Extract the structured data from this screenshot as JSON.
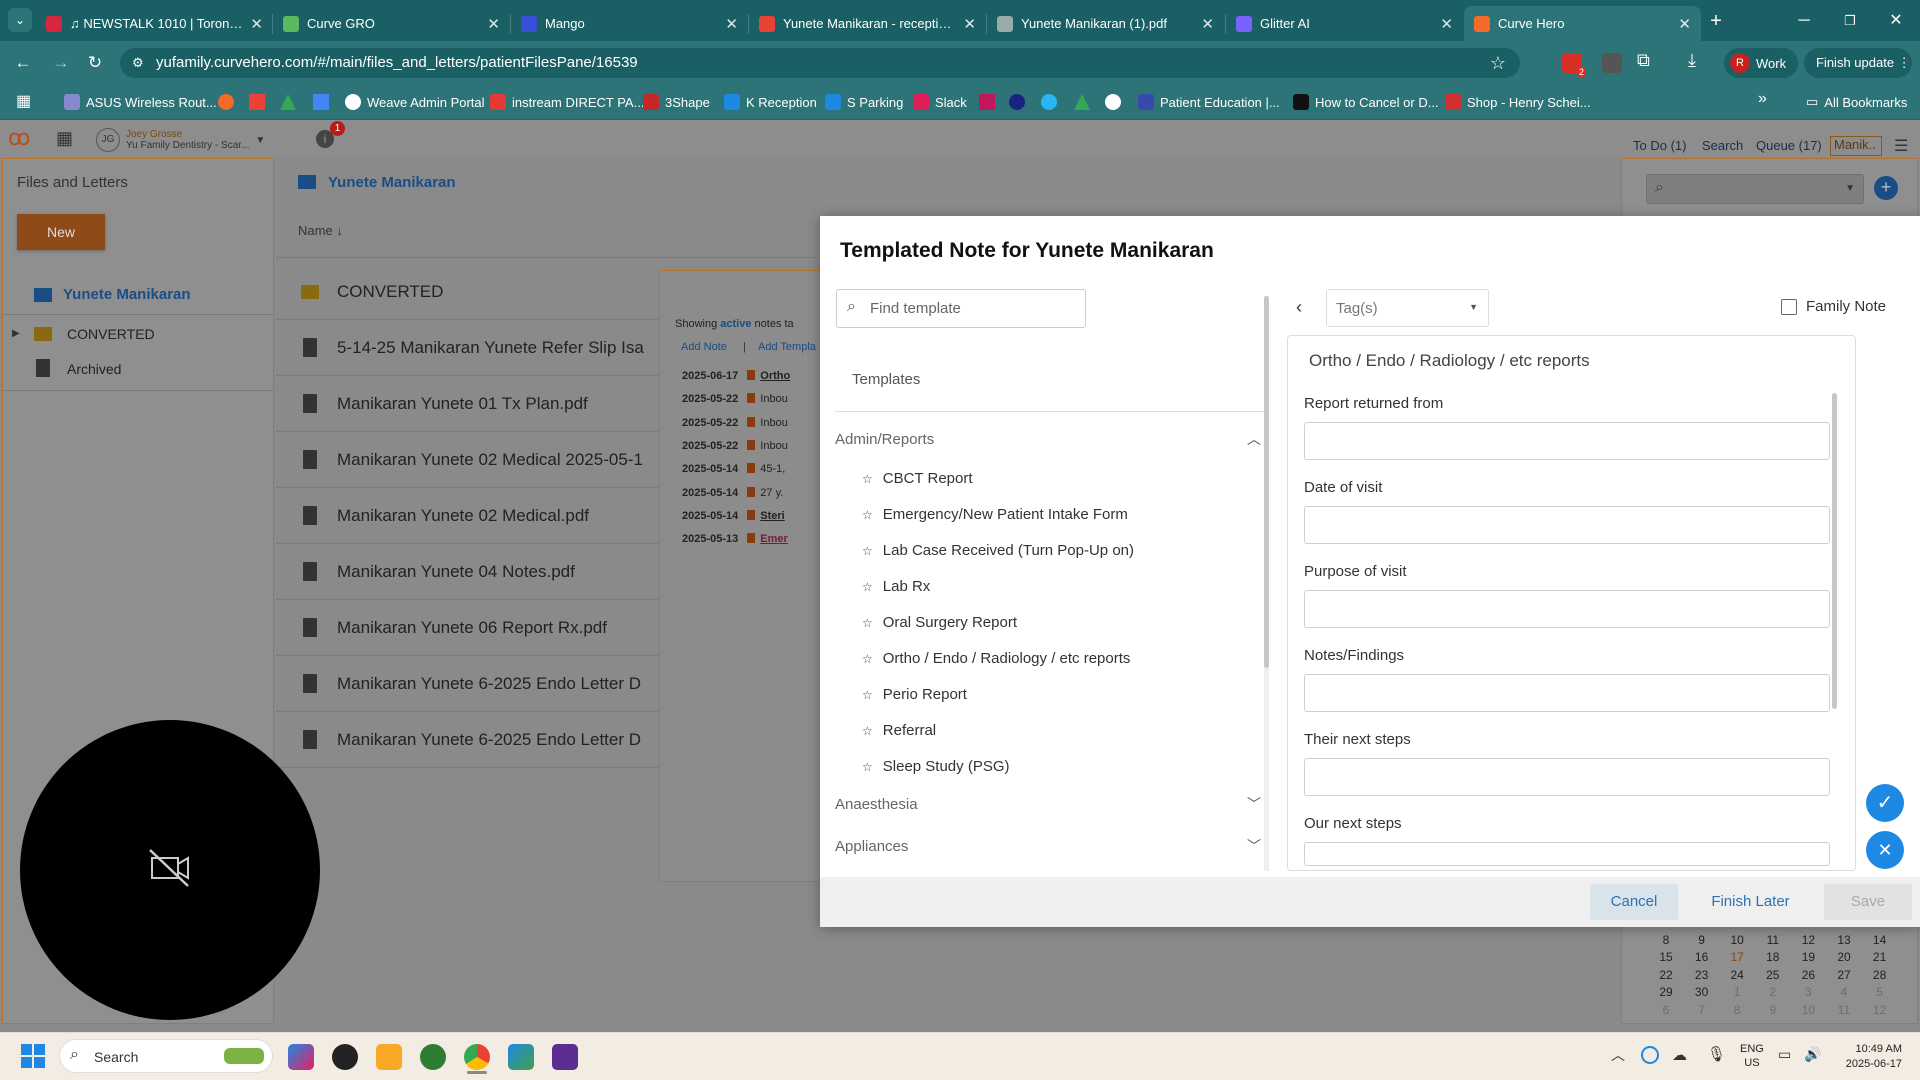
{
  "browser": {
    "tabs": [
      {
        "title": "♫ NEWSTALK 1010 | Toronto's r",
        "icon": "heart-radio-icon",
        "color": "#d7263d"
      },
      {
        "title": "Curve GRO",
        "icon": "curve-gro-icon",
        "color": "#5cb85c"
      },
      {
        "title": "Mango",
        "icon": "mango-icon",
        "color": "#3a4fd8"
      },
      {
        "title": "Yunete Manikaran - reception@",
        "icon": "gmail-icon",
        "color": "#ea4335"
      },
      {
        "title": "Yunete Manikaran (1).pdf",
        "icon": "globe-icon",
        "color": "#9aa"
      },
      {
        "title": "Glitter AI",
        "icon": "glitter-icon",
        "color": "#7b61ff"
      },
      {
        "title": "Curve Hero",
        "icon": "curve-hero-icon",
        "color": "#f26b2a"
      }
    ],
    "url": "yufamily.curvehero.com/#/main/files_and_letters/patientFilesPane/16539",
    "profile_label": "Work",
    "profile_initial": "R",
    "finish_update_label": "Finish update",
    "ext_badge": "2",
    "bookmarks": [
      "ASUS Wireless Rout...",
      "Weave Admin Portal",
      "instream DIRECT PA...",
      "3Shape",
      "K Reception",
      "S Parking",
      "Slack",
      "Patient Education |...",
      "How to Cancel or D...",
      "Shop - Henry Schei..."
    ],
    "all_bookmarks": "All Bookmarks"
  },
  "app": {
    "user_initials": "JG",
    "user_name": "Joey Grosse",
    "practice": "Yu Family Dentistry - Scar...",
    "info_badge": "1",
    "top_links": [
      "To Do (1)",
      "Search",
      "Queue (17)",
      "Manik.."
    ],
    "sidebar": {
      "title": "Files and Letters",
      "new_label": "New",
      "patient": "Yunete Manikaran",
      "folders": [
        "CONVERTED",
        "Archived"
      ]
    },
    "files": {
      "header": "Yunete Manikaran",
      "name_col": "Name",
      "items": [
        "CONVERTED",
        "5-14-25 Manikaran Yunete Refer Slip Isa",
        "Manikaran Yunete 01 Tx Plan.pdf",
        "Manikaran Yunete 02 Medical 2025-05-1",
        "Manikaran Yunete 02 Medical.pdf",
        "Manikaran Yunete 04 Notes.pdf",
        "Manikaran Yunete 06 Report Rx.pdf",
        "Manikaran Yunete 6-2025 Endo Letter D",
        "Manikaran Yunete 6-2025 Endo Letter D"
      ]
    },
    "notes_panel": {
      "showing": "Showing",
      "active": "active",
      "notes_tag": "notes ta",
      "add_note": "Add Note",
      "sep": "|",
      "add_template": "Add Templa",
      "rows": [
        {
          "date": "2025-06-17",
          "text": "Ortho"
        },
        {
          "date": "2025-05-22",
          "text": "Inbou"
        },
        {
          "date": "2025-05-22",
          "text": "Inbou"
        },
        {
          "date": "2025-05-22",
          "text": "Inbou"
        },
        {
          "date": "2025-05-14",
          "text": "45-1,"
        },
        {
          "date": "2025-05-14",
          "text": "27 y."
        },
        {
          "date": "2025-05-14",
          "text": "Steri"
        },
        {
          "date": "2025-05-13",
          "text": "Emer"
        }
      ]
    },
    "calendar": {
      "weeks": [
        [
          "8",
          "9",
          "10",
          "11",
          "12",
          "13",
          "14"
        ],
        [
          "15",
          "16",
          "17",
          "18",
          "19",
          "20",
          "21"
        ],
        [
          "22",
          "23",
          "24",
          "25",
          "26",
          "27",
          "28"
        ],
        [
          "29",
          "30",
          "1",
          "2",
          "3",
          "4",
          "5"
        ],
        [
          "6",
          "7",
          "8",
          "9",
          "10",
          "11",
          "12"
        ]
      ]
    }
  },
  "modal": {
    "title": "Templated Note for Yunete Manikaran",
    "find_placeholder": "Find template",
    "templates_tab": "Templates",
    "category_open": "Admin/Reports",
    "templates": [
      "CBCT Report",
      "Emergency/New Patient Intake Form",
      "Lab Case Received (Turn Pop-Up on)",
      "Lab Rx",
      "Oral Surgery Report",
      "Ortho / Endo / Radiology / etc reports",
      "Perio Report",
      "Referral",
      "Sleep Study (PSG)"
    ],
    "categories_closed": [
      "Anaesthesia",
      "Appliances"
    ],
    "tags_placeholder": "Tag(s)",
    "family_note": "Family Note",
    "form_title": "Ortho / Endo / Radiology / etc reports",
    "fields": [
      "Report returned from",
      "Date of visit",
      "Purpose of visit",
      "Notes/Findings",
      "Their next steps",
      "Our next steps"
    ],
    "cancel": "Cancel",
    "finish_later": "Finish Later",
    "save": "Save"
  },
  "taskbar": {
    "search": "Search",
    "lang1": "ENG",
    "lang2": "US",
    "time": "10:49 AM",
    "date": "2025-06-17"
  }
}
